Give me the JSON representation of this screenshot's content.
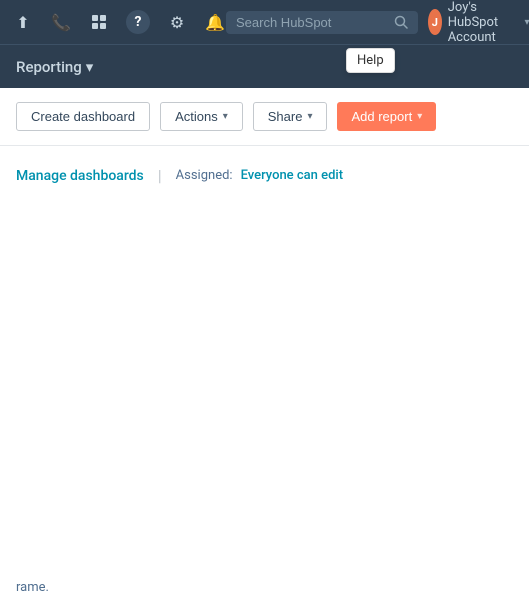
{
  "topnav": {
    "icons": [
      {
        "name": "upload-icon",
        "symbol": "⬆",
        "label": "upload"
      },
      {
        "name": "phone-icon",
        "symbol": "📞",
        "label": "phone"
      },
      {
        "name": "grid-icon",
        "symbol": "⊞",
        "label": "marketplace"
      },
      {
        "name": "help-icon",
        "symbol": "?",
        "label": "help"
      },
      {
        "name": "settings-icon",
        "symbol": "⚙",
        "label": "settings"
      },
      {
        "name": "notifications-icon",
        "symbol": "🔔",
        "label": "notifications"
      }
    ],
    "help_tooltip": "Help",
    "search_placeholder": "Search HubSpot",
    "account": {
      "label": "Joy's HubSpot Account",
      "avatar_text": "J"
    }
  },
  "subnav": {
    "title": "Reporting",
    "chevron": "▾"
  },
  "toolbar": {
    "create_dashboard_label": "Create dashboard",
    "actions_label": "Actions",
    "share_label": "Share",
    "add_report_label": "Add report"
  },
  "main": {
    "manage_dashboards_label": "Manage dashboards",
    "assigned_label": "Assigned:",
    "assigned_value": "Everyone can edit"
  },
  "footer": {
    "text": "rame."
  }
}
